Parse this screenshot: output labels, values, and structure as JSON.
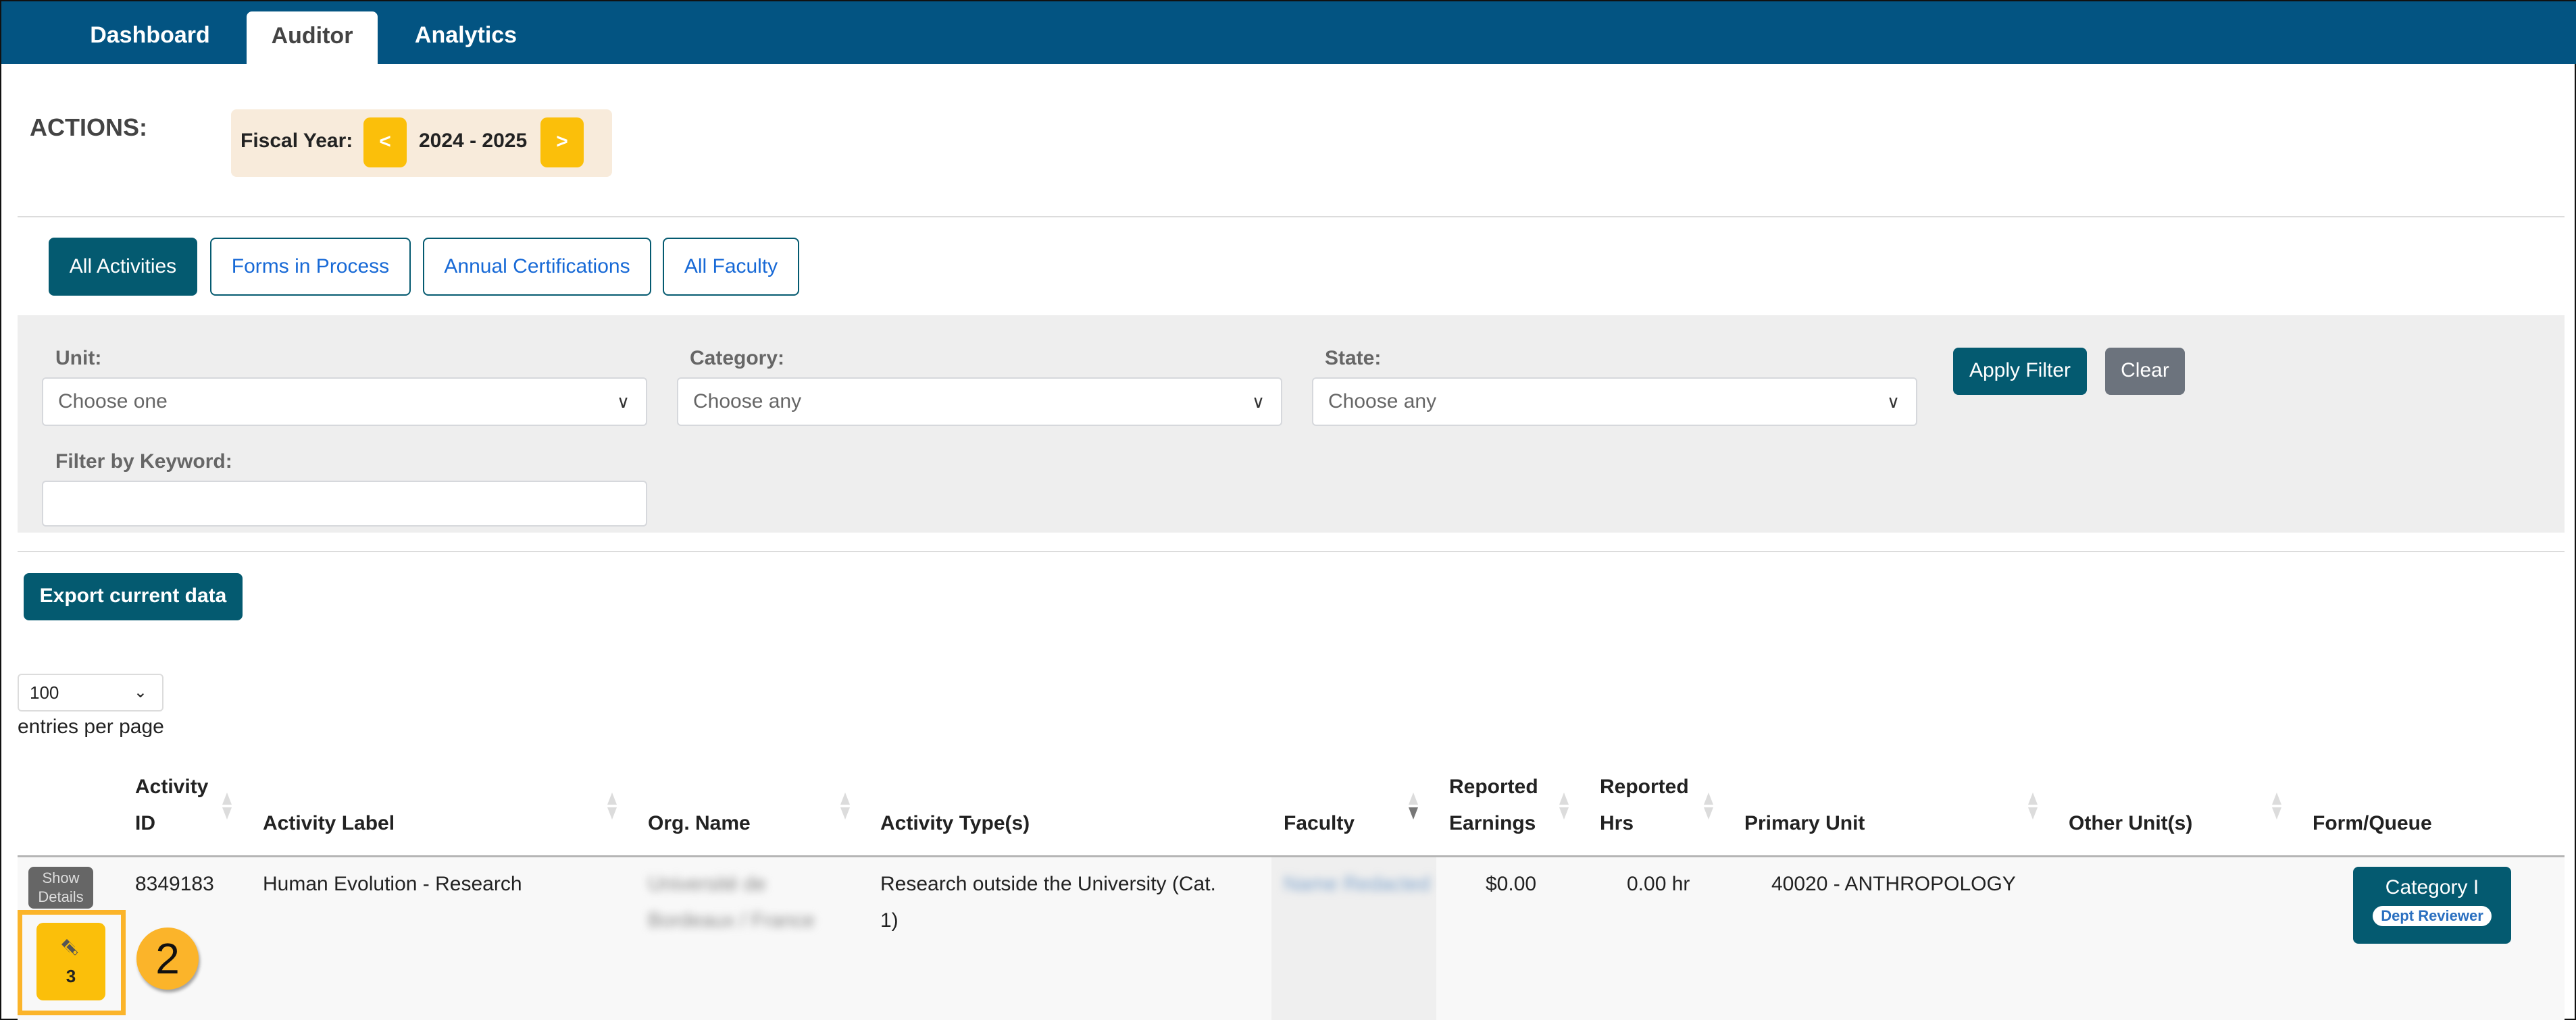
{
  "nav": {
    "tabs": [
      {
        "label": "Dashboard",
        "active": false
      },
      {
        "label": "Auditor",
        "active": true
      },
      {
        "label": "Analytics",
        "active": false
      }
    ]
  },
  "actions": {
    "label": "ACTIONS:",
    "fiscal_year_label": "Fiscal Year:",
    "fiscal_year_value": "2024 - 2025",
    "prev_label": "<",
    "next_label": ">"
  },
  "view_tabs": [
    {
      "label": "All Activities",
      "active": true
    },
    {
      "label": "Forms in Process",
      "active": false
    },
    {
      "label": "Annual Certifications",
      "active": false
    },
    {
      "label": "All Faculty",
      "active": false
    }
  ],
  "filters": {
    "unit": {
      "label": "Unit:",
      "value": "Choose one"
    },
    "category": {
      "label": "Category:",
      "value": "Choose any"
    },
    "state": {
      "label": "State:",
      "value": "Choose any"
    },
    "keyword": {
      "label": "Filter by Keyword:",
      "value": ""
    },
    "apply_label": "Apply Filter",
    "clear_label": "Clear"
  },
  "export_label": "Export current data",
  "entries": {
    "value": "100",
    "label": "entries per page"
  },
  "table": {
    "columns": [
      {
        "line1": "Activity",
        "line2": "ID"
      },
      {
        "line1": "",
        "line2": "Activity Label"
      },
      {
        "line1": "",
        "line2": "Org. Name"
      },
      {
        "line1": "",
        "line2": "Activity Type(s)"
      },
      {
        "line1": "",
        "line2": "Faculty"
      },
      {
        "line1": "Reported",
        "line2": "Earnings"
      },
      {
        "line1": "Reported",
        "line2": "Hrs"
      },
      {
        "line1": "",
        "line2": "Primary Unit"
      },
      {
        "line1": "",
        "line2": "Other Unit(s)"
      },
      {
        "line1": "",
        "line2": "Form/Queue"
      }
    ],
    "rows": [
      {
        "show_details_label": "Show Details",
        "tag_count": "3",
        "activity_id": "8349183",
        "activity_label": "Human Evolution - Research",
        "org_name_line1": "Université de",
        "org_name_line2": "Bordeaux / France",
        "activity_type_line1": "Research outside the University (Cat.",
        "activity_type_line2": "1)",
        "faculty": "Name Redacted",
        "reported_earnings": "$0.00",
        "reported_hrs": "0.00 hr",
        "primary_unit": "40020 - ANTHROPOLOGY",
        "other_units": "",
        "form_queue_label": "Category I",
        "form_queue_badge": "Dept Reviewer"
      }
    ]
  },
  "annotation": {
    "step_number": "2"
  },
  "colors": {
    "nav_bg": "#035482",
    "primary": "#045a70",
    "accent_yellow": "#fbbf0a",
    "highlight_orange": "#fbb42a",
    "secondary_gray": "#6c737d",
    "link_blue": "#1769d6"
  }
}
